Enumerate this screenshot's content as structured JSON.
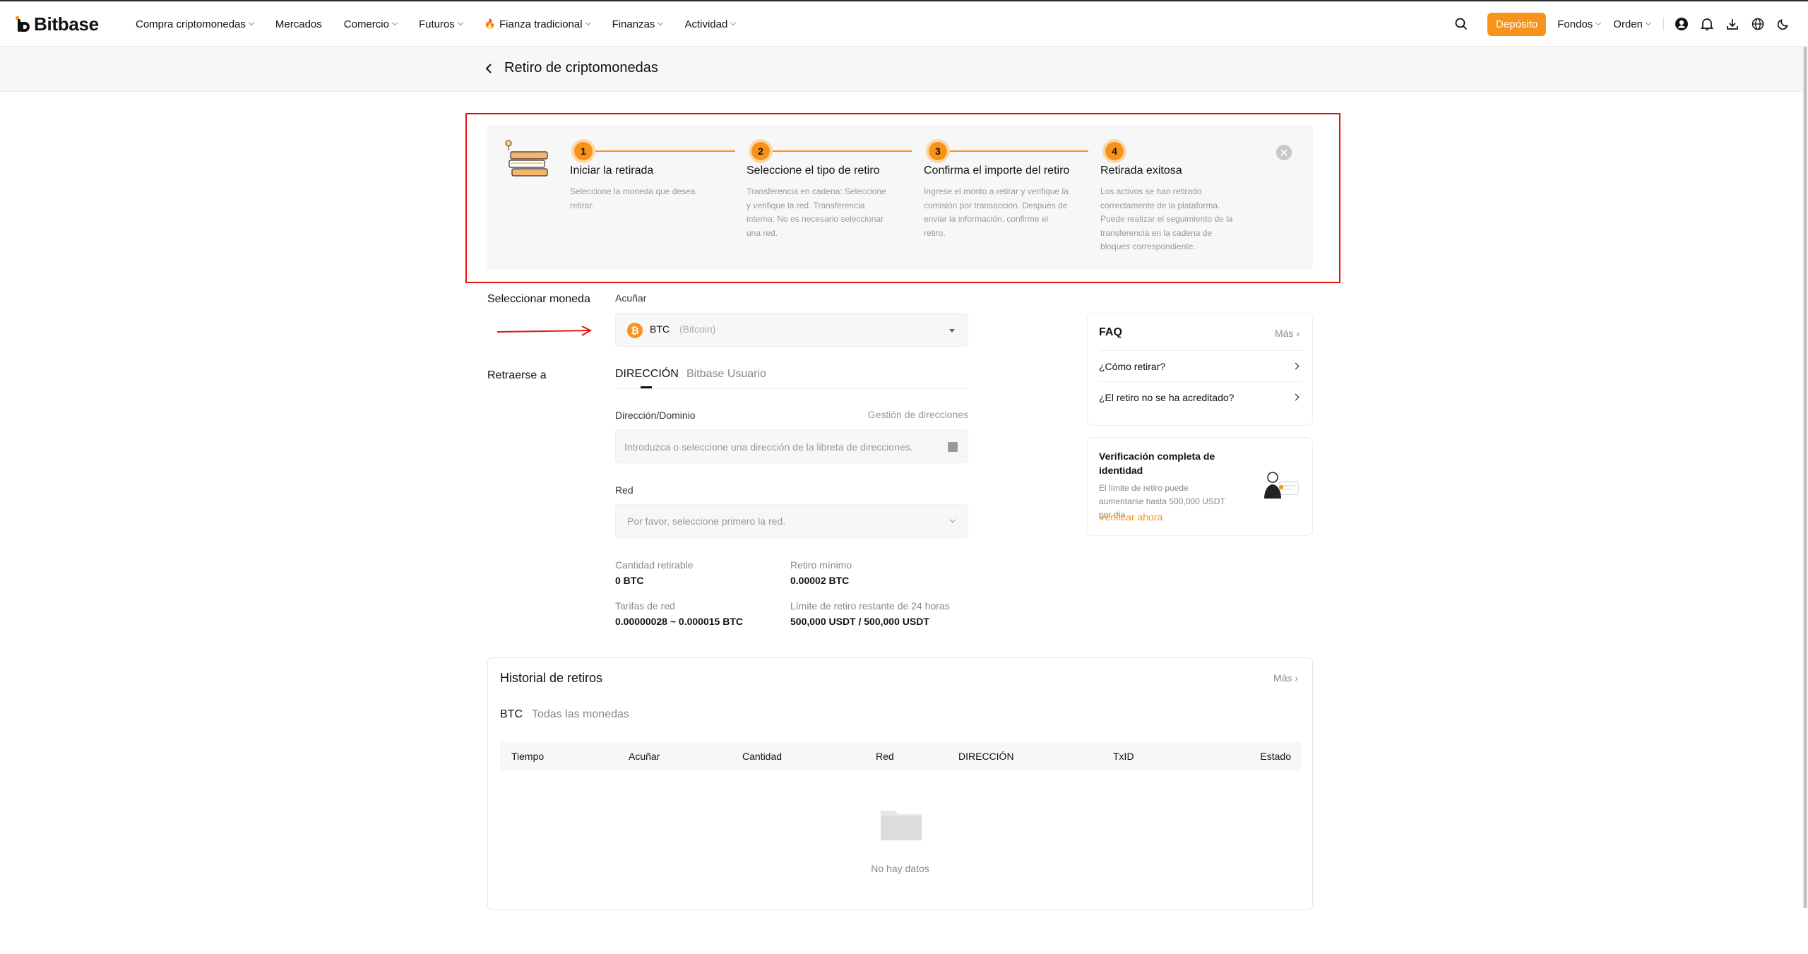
{
  "nav": {
    "logo": "Bitbase",
    "items": [
      "Compra criptomonedas",
      "Mercados",
      "Comercio",
      "Futuros",
      "Fianza tradicional",
      "Finanzas",
      "Actividad"
    ],
    "deposit": "Depósito",
    "funds": "Fondos",
    "orders": "Orden"
  },
  "page": {
    "title": "Retiro de criptomonedas"
  },
  "steps": [
    {
      "num": "1",
      "title": "Iniciar la retirada",
      "desc": "Seleccione la moneda que desea retirar."
    },
    {
      "num": "2",
      "title": "Seleccione el tipo de retiro",
      "desc": "Transferencia en cadena: Seleccione y verifique la red. Transferencia interna: No es necesario seleccionar una red."
    },
    {
      "num": "3",
      "title": "Confirma el importe del retiro",
      "desc": "Ingrese el monto a retirar y verifique la comisión por transacción. Después de enviar la información, confirme el retiro."
    },
    {
      "num": "4",
      "title": "Retirada exitosa",
      "desc": "Los activos se han retirado correctamente de la plataforma. Puede realizar el seguimiento de la transferencia en la cadena de bloques correspondiente."
    }
  ],
  "form": {
    "select_coin_label": "Seleccionar moneda",
    "coin_field_label": "Acuñar",
    "coin": "BTC",
    "coin_full": "(Bitcoin)",
    "withdraw_to_label": "Retraerse a",
    "tab_address": "DIRECCIÓN",
    "tab_user": "Bitbase Usuario",
    "address_label": "Dirección/Dominio",
    "address_mgmt": "Gestión de direcciones",
    "address_placeholder": "Introduzca o seleccione una dirección de la libreta de direcciones.",
    "network_label": "Red",
    "network_placeholder": "Por favor, seleccione primero la red.",
    "withdrawable_label": "Cantidad retirable",
    "withdrawable_value": "0 BTC",
    "min_label": "Retiro mínimo",
    "min_value": "0.00002 BTC",
    "fee_label": "Tarifas de red",
    "fee_value": "0.00000028 ~ 0.000015 BTC",
    "limit_label": "Límite de retiro restante de 24 horas",
    "limit_value": "500,000 USDT / 500,000 USDT"
  },
  "faq": {
    "title": "FAQ",
    "more": "Más",
    "items": [
      "¿Cómo retirar?",
      "¿El retiro no se ha acreditado?"
    ]
  },
  "verify": {
    "title": "Verificación completa de identidad",
    "desc": "El límite de retiro puede aumentarse hasta 500,000 USDT por día",
    "link": "Verificar ahora"
  },
  "history": {
    "title": "Historial de retiros",
    "more": "Más",
    "tab_btc": "BTC",
    "tab_all": "Todas las monedas",
    "columns": [
      "Tiempo",
      "Acuñar",
      "Cantidad",
      "Red",
      "DIRECCIÓN",
      "TxID",
      "Estado"
    ],
    "empty": "No hay datos"
  },
  "colors": {
    "accent": "#f7931a",
    "highlight_box": "#e11414"
  }
}
